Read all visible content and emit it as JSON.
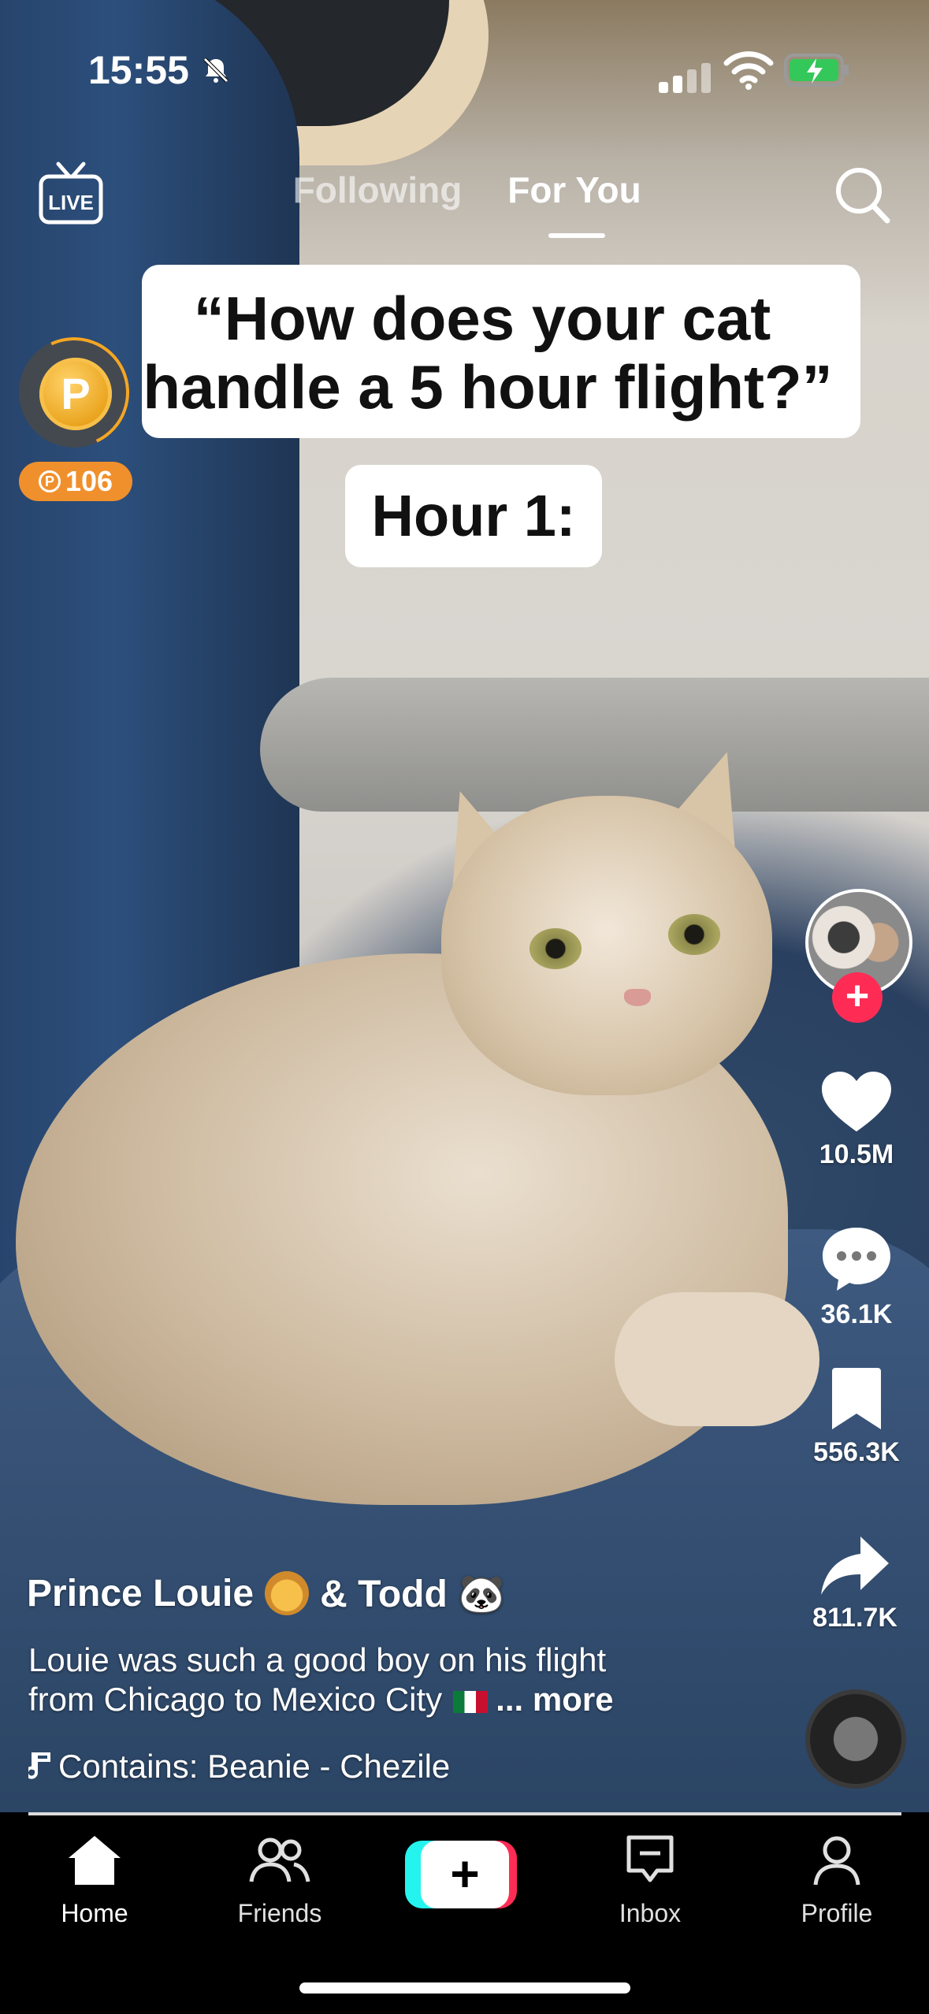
{
  "status_bar": {
    "time": "15:55",
    "icons": [
      "bell-slash-icon",
      "signal-icon",
      "wifi-icon",
      "battery-charging-icon"
    ]
  },
  "top_nav": {
    "live_label": "LIVE",
    "tabs": [
      {
        "label": "Following",
        "selected": false
      },
      {
        "label": "For You",
        "selected": true
      }
    ]
  },
  "video": {
    "caption_line1": "“How does your cat",
    "caption_line2": "handle a 5 hour flight?”",
    "overlay_text": "Hour 1:",
    "progress_fraction": 1.0
  },
  "coin_widget": {
    "symbol": "P",
    "count": "106"
  },
  "rail": {
    "likes": "10.5M",
    "comments": "36.1K",
    "saves": "556.3K",
    "shares": "811.7K"
  },
  "post": {
    "author": "Prince Louie",
    "author_suffix": "& Todd 🐼",
    "description_line1": "Louie was such a good boy on his flight",
    "description_line2": "from Chicago to Mexico City",
    "more_label": "... more",
    "music": "Contains: Beanie - Chezile"
  },
  "tab_bar": {
    "home": "Home",
    "friends": "Friends",
    "create": "+",
    "inbox": "Inbox",
    "profile": "Profile"
  },
  "colors": {
    "accent_red": "#fe2c55",
    "accent_cyan": "#25f4ee",
    "coin_orange": "#f0902c"
  }
}
